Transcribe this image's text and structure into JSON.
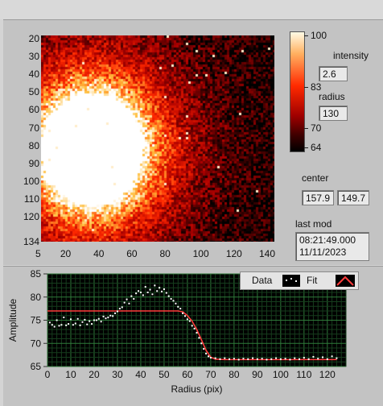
{
  "image_panel": {
    "y_ticks": [
      "20",
      "30",
      "40",
      "50",
      "60",
      "70",
      "80",
      "90",
      "100",
      "110",
      "120",
      "134"
    ],
    "x_ticks": [
      "5",
      "20",
      "40",
      "60",
      "80",
      "100",
      "120",
      "140"
    ]
  },
  "colorbar": {
    "ticks": [
      "100",
      "83",
      "70",
      "64"
    ],
    "colors": [
      "#fffbe6",
      "#ffb060",
      "#ff2a00",
      "#a00000",
      "#400000",
      "#000000"
    ]
  },
  "intensity": {
    "label": "intensity",
    "value": "2.6"
  },
  "radius": {
    "label": "radius",
    "value": "130"
  },
  "center": {
    "label": "center",
    "x": "157.9",
    "y": "149.7"
  },
  "last_mod": {
    "label": "last mod",
    "time": "08:21:49.000",
    "date": "11/11/2023"
  },
  "chart_data": {
    "type": "scatter",
    "xlabel": "Radius (pix)",
    "ylabel": "Amplitude",
    "xlim": [
      0,
      128
    ],
    "ylim": [
      65,
      85
    ],
    "x_ticks": [
      "0",
      "10",
      "20",
      "30",
      "40",
      "50",
      "60",
      "70",
      "80",
      "90",
      "100",
      "110",
      "120"
    ],
    "y_ticks": [
      "85",
      "80",
      "75",
      "70",
      "65"
    ],
    "legend": [
      {
        "name": "Data",
        "color": "#ffffff"
      },
      {
        "name": "Fit",
        "color": "#ff3b3b"
      }
    ],
    "series": [
      {
        "name": "Data",
        "points": [
          [
            1,
            74.5
          ],
          [
            2,
            74.0
          ],
          [
            3,
            73.6
          ],
          [
            4,
            75.0
          ],
          [
            5,
            73.8
          ],
          [
            6,
            74.0
          ],
          [
            7,
            75.6
          ],
          [
            8,
            73.9
          ],
          [
            9,
            74.2
          ],
          [
            10,
            75.2
          ],
          [
            11,
            74.0
          ],
          [
            12,
            74.3
          ],
          [
            13,
            75.3
          ],
          [
            14,
            73.9
          ],
          [
            15,
            74.6
          ],
          [
            16,
            75.1
          ],
          [
            17,
            74.1
          ],
          [
            18,
            74.8
          ],
          [
            19,
            74.2
          ],
          [
            20,
            75.0
          ],
          [
            21,
            75.0
          ],
          [
            22,
            75.3
          ],
          [
            23,
            74.7
          ],
          [
            24,
            75.8
          ],
          [
            25,
            75.4
          ],
          [
            26,
            75.6
          ],
          [
            27,
            76.0
          ],
          [
            28,
            75.9
          ],
          [
            29,
            76.5
          ],
          [
            30,
            76.9
          ],
          [
            31,
            77.5
          ],
          [
            32,
            77.8
          ],
          [
            33,
            78.8
          ],
          [
            34,
            79.5
          ],
          [
            35,
            78.6
          ],
          [
            36,
            80.2
          ],
          [
            37,
            79.6
          ],
          [
            38,
            80.8
          ],
          [
            39,
            81.3
          ],
          [
            40,
            81.0
          ],
          [
            41,
            80.4
          ],
          [
            42,
            82.2
          ],
          [
            43,
            81.0
          ],
          [
            44,
            81.6
          ],
          [
            45,
            80.6
          ],
          [
            46,
            82.5
          ],
          [
            47,
            81.3
          ],
          [
            48,
            82.0
          ],
          [
            49,
            81.2
          ],
          [
            50,
            81.7
          ],
          [
            51,
            80.9
          ],
          [
            52,
            80.2
          ],
          [
            53,
            79.6
          ],
          [
            54,
            79.2
          ],
          [
            55,
            78.6
          ],
          [
            56,
            77.9
          ],
          [
            57,
            77.5
          ],
          [
            58,
            76.5
          ],
          [
            59,
            75.9
          ],
          [
            60,
            75.2
          ],
          [
            61,
            74.8
          ],
          [
            62,
            73.8
          ],
          [
            63,
            73.2
          ],
          [
            64,
            72.3
          ],
          [
            65,
            71.2
          ],
          [
            66,
            70.0
          ],
          [
            67,
            68.8
          ],
          [
            68,
            67.8
          ],
          [
            69,
            67.2
          ],
          [
            70,
            66.9
          ],
          [
            72,
            66.8
          ],
          [
            74,
            66.6
          ],
          [
            76,
            66.8
          ],
          [
            78,
            66.6
          ],
          [
            80,
            66.7
          ],
          [
            82,
            66.5
          ],
          [
            84,
            66.7
          ],
          [
            86,
            66.6
          ],
          [
            88,
            66.8
          ],
          [
            90,
            66.6
          ],
          [
            92,
            66.7
          ],
          [
            94,
            66.5
          ],
          [
            96,
            66.6
          ],
          [
            98,
            66.8
          ],
          [
            100,
            66.6
          ],
          [
            102,
            66.7
          ],
          [
            104,
            66.5
          ],
          [
            106,
            66.8
          ],
          [
            108,
            66.6
          ],
          [
            110,
            66.9
          ],
          [
            112,
            66.6
          ],
          [
            114,
            67.1
          ],
          [
            116,
            66.7
          ],
          [
            118,
            67.0
          ],
          [
            120,
            66.6
          ],
          [
            122,
            67.2
          ],
          [
            124,
            66.8
          ]
        ]
      },
      {
        "name": "Fit",
        "points": [
          [
            0,
            77.0
          ],
          [
            56,
            77.0
          ],
          [
            58,
            76.8
          ],
          [
            60,
            76.0
          ],
          [
            62,
            74.8
          ],
          [
            64,
            73.0
          ],
          [
            66,
            70.8
          ],
          [
            68,
            68.5
          ],
          [
            70,
            67.0
          ],
          [
            72,
            66.6
          ],
          [
            76,
            66.5
          ],
          [
            124,
            66.5
          ]
        ]
      }
    ]
  }
}
